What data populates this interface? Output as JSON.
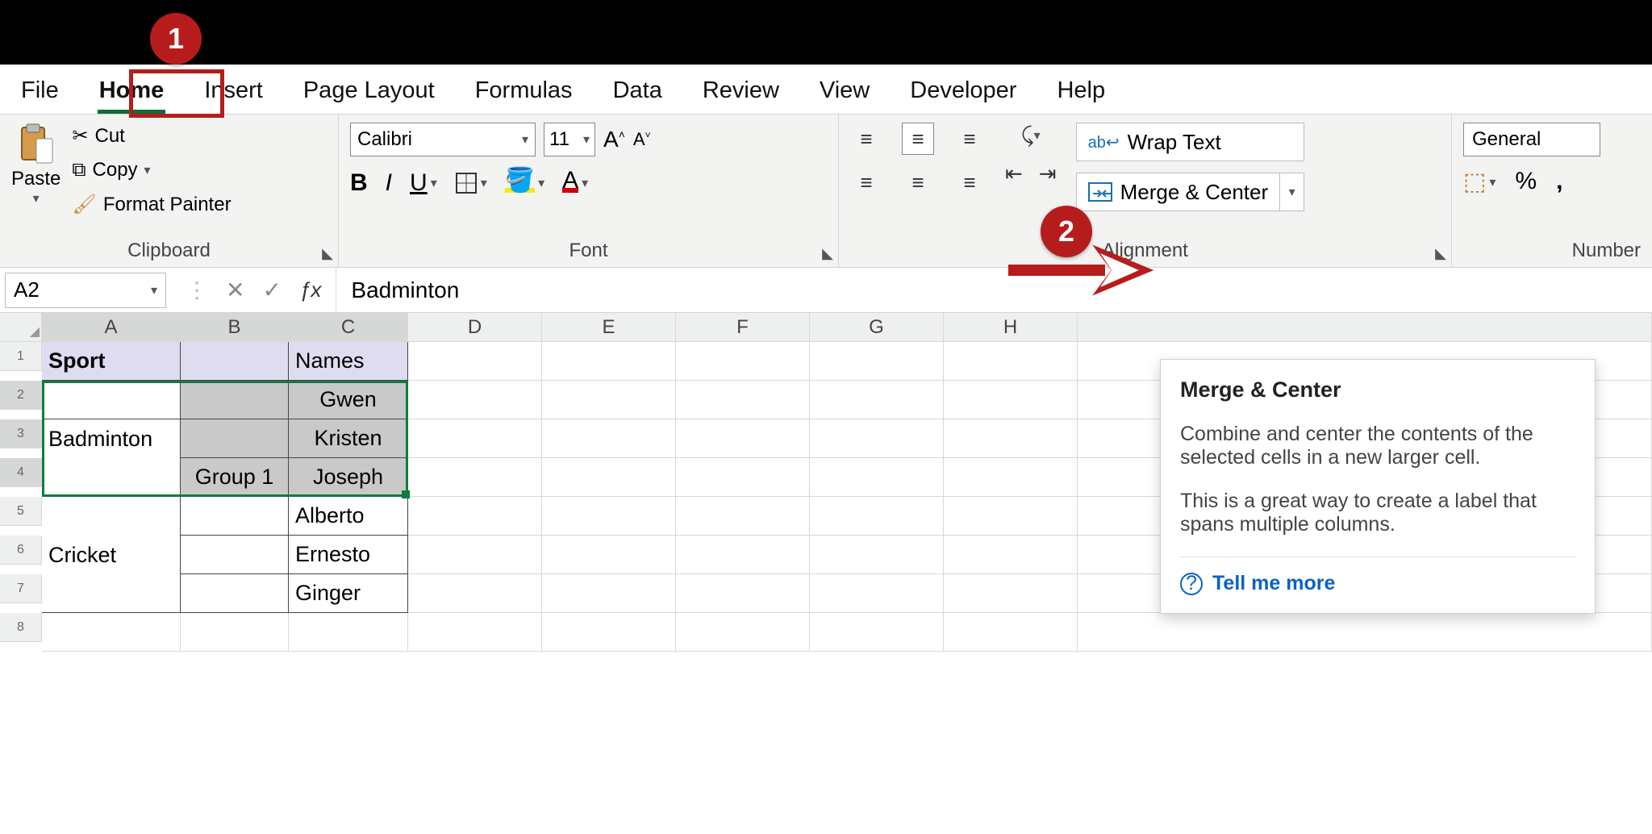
{
  "callouts": {
    "one": "1",
    "two": "2"
  },
  "ribbon": {
    "tabs": [
      "File",
      "Home",
      "Insert",
      "Page Layout",
      "Formulas",
      "Data",
      "Review",
      "View",
      "Developer",
      "Help"
    ],
    "active_tab": "Home",
    "clipboard": {
      "paste": "Paste",
      "cut": "Cut",
      "copy": "Copy",
      "format_painter": "Format Painter",
      "group": "Clipboard"
    },
    "font": {
      "name": "Calibri",
      "size": "11",
      "group": "Font"
    },
    "alignment": {
      "wrap": "Wrap Text",
      "merge": "Merge & Center",
      "group": "Alignment"
    },
    "number": {
      "format": "General",
      "group": "Number"
    }
  },
  "formula_bar": {
    "name_box": "A2",
    "value": "Badminton"
  },
  "grid": {
    "columns": [
      "A",
      "B",
      "C",
      "D",
      "E",
      "F",
      "G",
      "H"
    ],
    "rows": [
      {
        "n": "1",
        "A": "Sport",
        "B": "",
        "C": "Names"
      },
      {
        "n": "2",
        "A": "",
        "B": "",
        "C": "Gwen"
      },
      {
        "n": "3",
        "A": "Badminton",
        "B": "",
        "C": "Kristen"
      },
      {
        "n": "4",
        "A": "",
        "B": "Group 1",
        "C": "Joseph"
      },
      {
        "n": "5",
        "A": "",
        "B": "",
        "C": "Alberto"
      },
      {
        "n": "6",
        "A": "Cricket",
        "B": "",
        "C": "Ernesto"
      },
      {
        "n": "7",
        "A": "",
        "B": "",
        "C": "Ginger"
      },
      {
        "n": "8",
        "A": "",
        "B": "",
        "C": ""
      }
    ],
    "selection": "A2:C4"
  },
  "tooltip": {
    "title": "Merge & Center",
    "p1": "Combine and center the contents of the selected cells in a new larger cell.",
    "p2": "This is a great way to create a label that spans multiple columns.",
    "link": "Tell me more"
  }
}
